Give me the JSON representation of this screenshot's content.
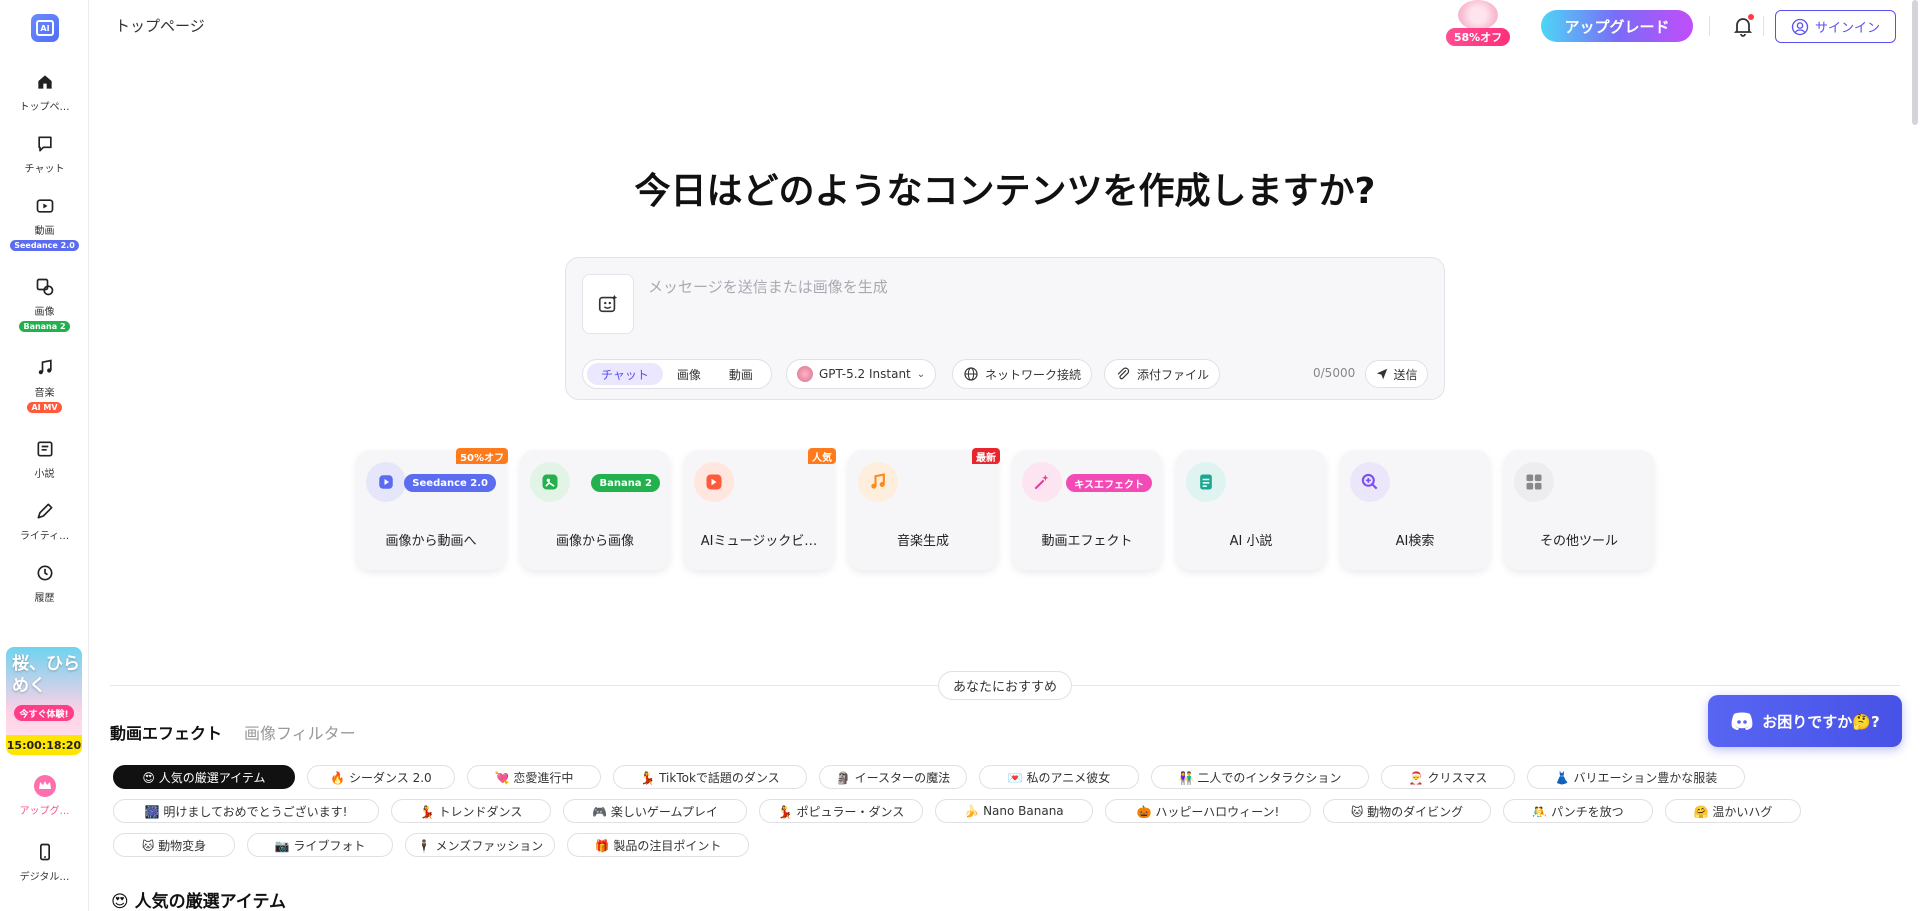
{
  "sidebar": {
    "items": [
      {
        "label": "トップペ…",
        "badge": "",
        "badge_color": ""
      },
      {
        "label": "チャット",
        "badge": "",
        "badge_color": ""
      },
      {
        "label": "動画",
        "badge": "Seedance 2.0",
        "badge_color": "#5b6cf0"
      },
      {
        "label": "画像",
        "badge": "Banana 2",
        "badge_color": "#22b14c"
      },
      {
        "label": "音楽",
        "badge": "AI MV",
        "badge_color": "#ff5a3c"
      },
      {
        "label": "小説",
        "badge": "",
        "badge_color": ""
      },
      {
        "label": "ライティ…",
        "badge": "",
        "badge_color": ""
      },
      {
        "label": "履歴",
        "badge": "",
        "badge_color": ""
      },
      {
        "label": "アップグ…",
        "badge": "",
        "badge_color": ""
      },
      {
        "label": "デジタル…",
        "badge": "",
        "badge_color": ""
      }
    ],
    "promo": {
      "title_line1": "桜、ひら",
      "title_line2": "めく",
      "button": "今すぐ体験!",
      "timer": "15:00:18:20"
    }
  },
  "header": {
    "title": "トップページ",
    "sale": "58%オフ",
    "upgrade": "アップグレード",
    "signin": "サインイン"
  },
  "hero": {
    "title": "今日はどのようなコンテンツを作成しますか?",
    "placeholder": "メッセージを送信または画像を生成",
    "modes": [
      "チャット",
      "画像",
      "動画"
    ],
    "model": "GPT-5.2 Instant",
    "network": "ネットワーク接続",
    "attach": "添付ファイル",
    "counter": "0/5000",
    "send": "送信"
  },
  "tools": [
    {
      "label": "画像から動画へ",
      "tag": "Seedance 2.0",
      "tag_color": "#5b6cf0",
      "corner": "50%オフ",
      "corner_color": "#ff7a1a",
      "icon_bg": "#e6e6fb",
      "icon_color": "#5b6cf0"
    },
    {
      "label": "画像から画像",
      "tag": "Banana 2",
      "tag_color": "#22b14c",
      "corner": "",
      "corner_color": "",
      "icon_bg": "#e2f4e6",
      "icon_color": "#22b14c"
    },
    {
      "label": "AIミュージックビ…",
      "tag": "",
      "tag_color": "",
      "corner": "人気",
      "corner_color": "#ff7a1a",
      "icon_bg": "#ffe6df",
      "icon_color": "#ff5a3c"
    },
    {
      "label": "音楽生成",
      "tag": "",
      "tag_color": "",
      "corner": "最新",
      "corner_color": "#e8242c",
      "icon_bg": "#fdeedd",
      "icon_color": "#ff8a1a"
    },
    {
      "label": "動画エフェクト",
      "tag": "キスエフェクト",
      "tag_color": "#f24bb6",
      "corner": "",
      "corner_color": "",
      "icon_bg": "#fde4f1",
      "icon_color": "#e83aa0"
    },
    {
      "label": "AI 小説",
      "tag": "",
      "tag_color": "",
      "corner": "",
      "corner_color": "",
      "icon_bg": "#dff4f0",
      "icon_color": "#1aa891"
    },
    {
      "label": "AI検索",
      "tag": "",
      "tag_color": "",
      "corner": "",
      "corner_color": "",
      "icon_bg": "#ece6fb",
      "icon_color": "#7a4ff0"
    },
    {
      "label": "その他ツール",
      "tag": "",
      "tag_color": "",
      "corner": "",
      "corner_color": "",
      "icon_bg": "#ededf0",
      "icon_color": "#888"
    }
  ],
  "recommend": {
    "pill": "あなたにおすすめ",
    "tabs": [
      "動画エフェクト",
      "画像フィルター"
    ],
    "tags_row1": [
      "😍 人気の厳選アイテム",
      "🔥 シーダンス 2.0",
      "💘 恋愛進行中",
      "💃 TikTokで話題のダンス",
      "🗿 イースターの魔法",
      "💌 私のアニメ彼女",
      "👫 二人でのインタラクション",
      "🎅 クリスマス",
      "👗 バリエーション豊かな服装"
    ],
    "tags_row2": [
      "🎆 明けましておめでとうございます!",
      "💃 トレンドダンス",
      "🎮 楽しいゲームプレイ",
      "💃 ポピュラー・ダンス",
      "🍌 Nano Banana",
      "🎃 ハッピーハロウィーン!",
      "🐱 動物のダイビング",
      "🤼 パンチを放つ",
      "🤗 温かいハグ"
    ],
    "tags_row3": [
      "🐱 動物変身",
      "📷 ライブフォト",
      "🕴 メンズファッション",
      "🎁 製品の注目ポイント"
    ],
    "section_title": "😍 人気の厳選アイテム"
  },
  "help": {
    "label": "お困りですか🤔?"
  }
}
